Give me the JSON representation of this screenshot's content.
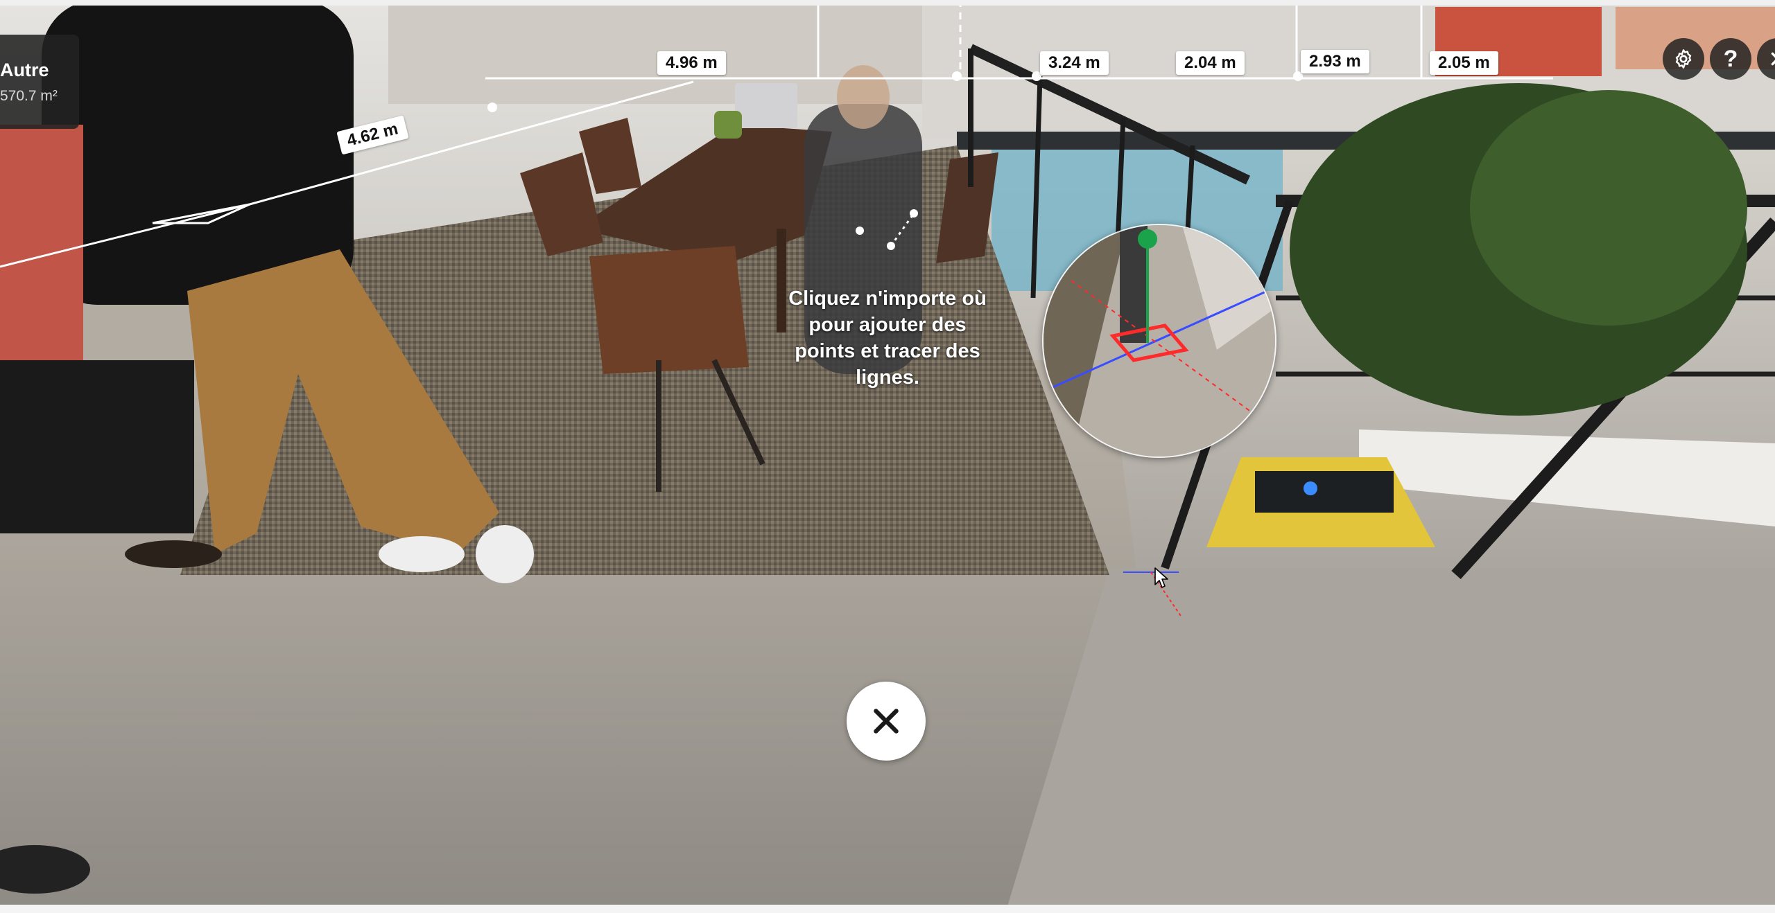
{
  "room": {
    "name": "Autre",
    "area": "570.7 m²"
  },
  "measurements": [
    {
      "id": "m1",
      "label": "4.62 m"
    },
    {
      "id": "m2",
      "label": "4.96 m"
    },
    {
      "id": "m3",
      "label": "3.24 m"
    },
    {
      "id": "m4",
      "label": "2.04 m"
    },
    {
      "id": "m5",
      "label": "2.93 m"
    },
    {
      "id": "m6",
      "label": "2.05 m"
    }
  ],
  "hint": {
    "line1": "Cliquez n'importe où",
    "line2": "pour ajouter des",
    "line3": "points et tracer des",
    "line4": "lignes."
  },
  "toolbar": {
    "settings_icon": "gear-icon",
    "help_label": "?",
    "exit_icon": "close-icon"
  },
  "close_measure_icon": "close-icon",
  "colors": {
    "overlay_dark": "#222222",
    "label_bg": "#ffffff",
    "loupe_up_axis": "#1aa34a",
    "loupe_target": "#ff2a2a",
    "loupe_horizon": "#3a4cff"
  }
}
